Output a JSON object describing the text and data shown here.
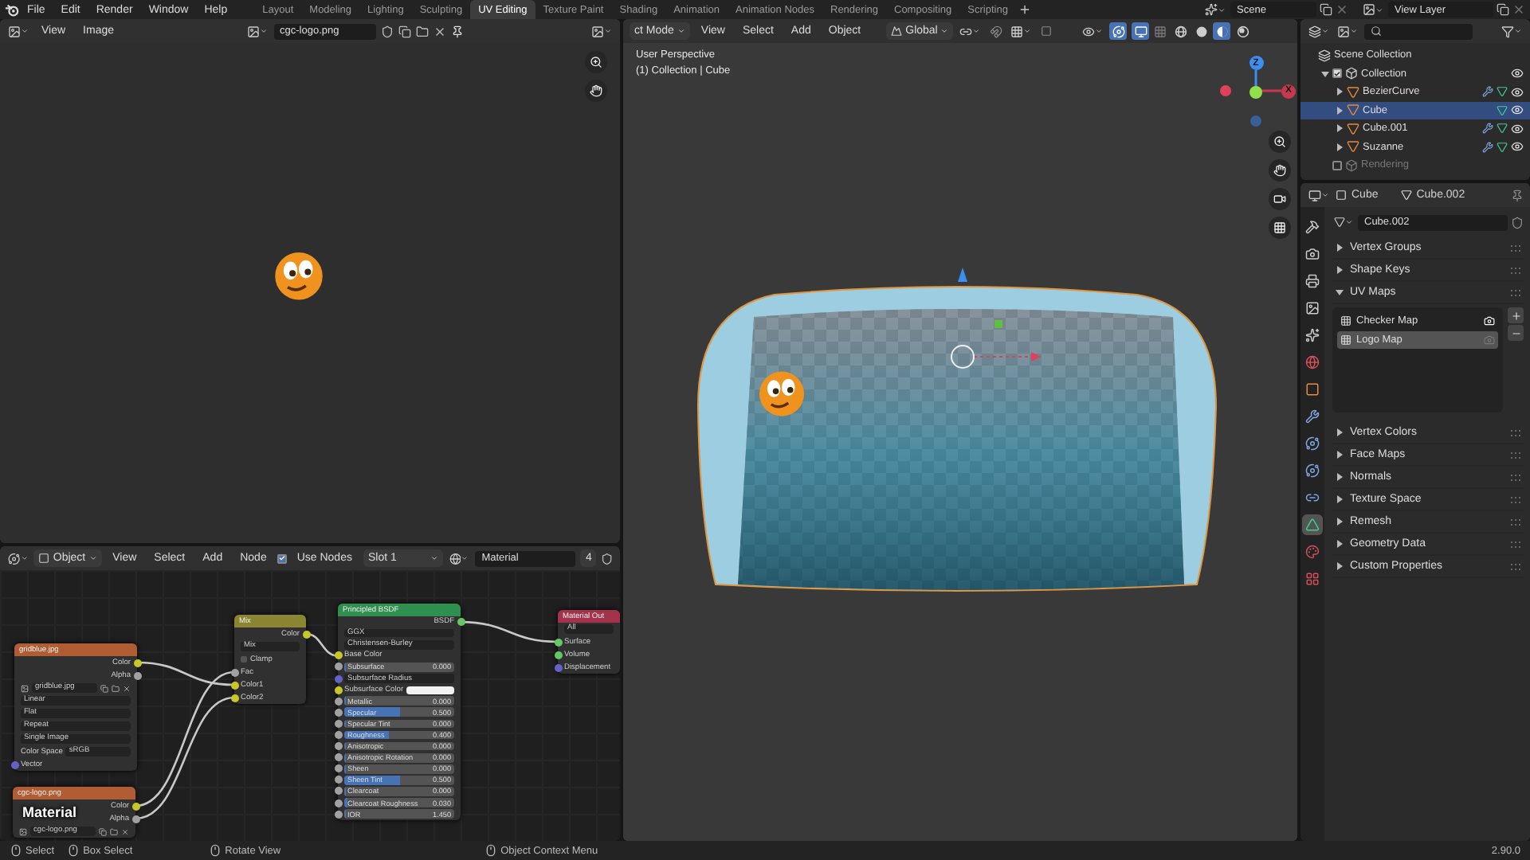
{
  "top_bar": {
    "menus": [
      "File",
      "Edit",
      "Render",
      "Window",
      "Help"
    ],
    "workspace_tabs": [
      {
        "label": "Layout",
        "selected": false
      },
      {
        "label": "Modeling",
        "selected": false
      },
      {
        "label": "Lighting",
        "selected": false
      },
      {
        "label": "Sculpting",
        "selected": false
      },
      {
        "label": "UV Editing",
        "selected": true
      },
      {
        "label": "Texture Paint",
        "selected": false
      },
      {
        "label": "Shading",
        "selected": false
      },
      {
        "label": "Animation",
        "selected": false
      },
      {
        "label": "Animation Nodes",
        "selected": false
      },
      {
        "label": "Rendering",
        "selected": false
      },
      {
        "label": "Compositing",
        "selected": false
      },
      {
        "label": "Scripting",
        "selected": false
      }
    ],
    "scene": "Scene",
    "view_layer": "View Layer"
  },
  "image_editor": {
    "menus": [
      "View",
      "Image"
    ],
    "image_name": "cgc-logo.png"
  },
  "node_editor": {
    "header": {
      "mode": "Object",
      "menus": [
        "View",
        "Select",
        "Add",
        "Node"
      ],
      "use_nodes": {
        "label": "Use Nodes",
        "checked": true
      },
      "slot": "Slot 1",
      "material": "Material",
      "users": "4"
    },
    "drag_label": "Material",
    "nodes": [
      {
        "title": "gridblue.jpg",
        "color": "#b05d33",
        "rows": [
          {
            "kind": "output",
            "label": "Color",
            "color": "#c7c729"
          },
          {
            "kind": "output",
            "label": "Alpha",
            "color": "#a1a1a1"
          },
          {
            "kind": "file",
            "value": "gridblue.jpg"
          },
          {
            "kind": "dropdown",
            "value": "Linear"
          },
          {
            "kind": "dropdown",
            "value": "Flat"
          },
          {
            "kind": "dropdown",
            "value": "Repeat"
          },
          {
            "kind": "dropdown",
            "value": "Single Image"
          },
          {
            "kind": "prop",
            "label": "Color Space",
            "value": "sRGB"
          },
          {
            "kind": "input",
            "label": "Vector",
            "color": "#6363c7"
          }
        ]
      },
      {
        "title": "cgc-logo.png",
        "color": "#b05d33",
        "rows": [
          {
            "kind": "output",
            "label": "Color",
            "color": "#c7c729"
          },
          {
            "kind": "output",
            "label": "Alpha",
            "color": "#a1a1a1"
          },
          {
            "kind": "file",
            "value": "cgc-logo.png"
          }
        ]
      },
      {
        "title": "Mix",
        "color": "#8a8532",
        "rows": [
          {
            "kind": "output",
            "label": "Color",
            "color": "#c7c729"
          },
          {
            "kind": "dropdown",
            "value": "Mix"
          },
          {
            "kind": "checkbox",
            "label": "Clamp",
            "checked": false
          },
          {
            "kind": "input",
            "label": "Fac",
            "color": "#a1a1a1"
          },
          {
            "kind": "input",
            "label": "Color1",
            "color": "#c7c729"
          },
          {
            "kind": "input",
            "label": "Color2",
            "color": "#c7c729"
          }
        ]
      },
      {
        "title": "Principled BSDF",
        "color": "#2e8f4f",
        "rows": [
          {
            "kind": "output",
            "label": "BSDF",
            "color": "#63c763"
          },
          {
            "kind": "dropdown",
            "value": "GGX"
          },
          {
            "kind": "dropdown",
            "value": "Christensen-Burley"
          },
          {
            "kind": "input",
            "label": "Base Color",
            "color": "#c7c729"
          },
          {
            "kind": "value",
            "label": "Subsurface",
            "value": "0.000",
            "level": 0,
            "color": "#a1a1a1"
          },
          {
            "kind": "dropdown",
            "value": "Subsurface Radius",
            "color": "#6363c7"
          },
          {
            "kind": "color",
            "label": "Subsurface Color",
            "color": "#c7c729"
          },
          {
            "kind": "value",
            "label": "Metallic",
            "value": "0.000",
            "level": 0,
            "color": "#a1a1a1"
          },
          {
            "kind": "value",
            "label": "Specular",
            "value": "0.500",
            "level": 0.5,
            "color": "#a1a1a1"
          },
          {
            "kind": "value",
            "label": "Specular Tint",
            "value": "0.000",
            "level": 0,
            "color": "#a1a1a1"
          },
          {
            "kind": "value",
            "label": "Roughness",
            "value": "0.400",
            "level": 0.4,
            "color": "#a1a1a1"
          },
          {
            "kind": "value",
            "label": "Anisotropic",
            "value": "0.000",
            "level": 0,
            "color": "#a1a1a1"
          },
          {
            "kind": "value",
            "label": "Anisotropic Rotation",
            "value": "0.000",
            "level": 0,
            "color": "#a1a1a1"
          },
          {
            "kind": "value",
            "label": "Sheen",
            "value": "0.000",
            "level": 0,
            "color": "#a1a1a1"
          },
          {
            "kind": "value",
            "label": "Sheen Tint",
            "value": "0.500",
            "level": 0.5,
            "color": "#a1a1a1"
          },
          {
            "kind": "value",
            "label": "Clearcoat",
            "value": "0.000",
            "level": 0,
            "color": "#a1a1a1"
          },
          {
            "kind": "value",
            "label": "Clearcoat Roughness",
            "value": "0.030",
            "level": 0.03,
            "color": "#a1a1a1"
          },
          {
            "kind": "value",
            "label": "IOR",
            "value": "1.450",
            "level": 0,
            "color": "#a1a1a1"
          }
        ]
      },
      {
        "title": "Material Out",
        "color": "#a3334a",
        "rows": [
          {
            "kind": "dropdown",
            "value": "All"
          },
          {
            "kind": "input",
            "label": "Surface",
            "color": "#63c763"
          },
          {
            "kind": "input",
            "label": "Volume",
            "color": "#63c763"
          },
          {
            "kind": "input",
            "label": "Displacement",
            "color": "#6363c7"
          }
        ]
      }
    ]
  },
  "viewport": {
    "header": {
      "mode": "ct Mode",
      "menus": [
        "View",
        "Select",
        "Add",
        "Object"
      ],
      "orientation": "Global",
      "shading_modes": [
        {
          "kind": "wireframe",
          "selected": false
        },
        {
          "kind": "solid",
          "selected": false
        },
        {
          "kind": "material",
          "selected": true
        },
        {
          "kind": "rendered",
          "selected": false
        }
      ]
    },
    "info": [
      "User Perspective",
      "(1) Collection | Cube"
    ],
    "gizmo": {
      "z": "Z",
      "x": "X"
    }
  },
  "outliner": {
    "tree": [
      {
        "name": "Scene Collection",
        "kind": "scene",
        "selected": false,
        "children": [
          {
            "name": "Collection",
            "kind": "collection",
            "checked": true,
            "expanded": true,
            "selected": false,
            "children": [
              {
                "name": "BezierCurve",
                "kind": "object",
                "expanded": false,
                "selected": false,
                "modifiers": true
              },
              {
                "name": "Cube",
                "kind": "object",
                "expanded": false,
                "selected": true,
                "modifiers": false
              },
              {
                "name": "Cube.001",
                "kind": "object",
                "expanded": false,
                "selected": false,
                "modifiers": true
              },
              {
                "name": "Suzanne",
                "kind": "object",
                "expanded": false,
                "selected": false,
                "modifiers": true
              }
            ]
          },
          {
            "name": "Rendering",
            "kind": "collection",
            "checked": false,
            "selected": false
          }
        ]
      }
    ]
  },
  "properties": {
    "object": "Cube",
    "mesh": "Cube.002",
    "mesh_field": "Cube.002",
    "tabs": [
      {
        "kind": "tool",
        "selected": false
      },
      {
        "kind": "render",
        "selected": false
      },
      {
        "kind": "output",
        "selected": false
      },
      {
        "kind": "view_layer",
        "selected": false
      },
      {
        "kind": "scene",
        "selected": false
      },
      {
        "kind": "world",
        "selected": false
      },
      {
        "kind": "object",
        "selected": false
      },
      {
        "kind": "modifiers",
        "selected": false
      },
      {
        "kind": "particles",
        "selected": false
      },
      {
        "kind": "physics",
        "selected": false
      },
      {
        "kind": "constraints",
        "selected": false
      },
      {
        "kind": "data",
        "selected": true
      },
      {
        "kind": "material",
        "selected": false
      },
      {
        "kind": "texture",
        "selected": false
      }
    ],
    "panels": [
      {
        "label": "Vertex Groups",
        "expanded": false
      },
      {
        "label": "Shape Keys",
        "expanded": false
      },
      {
        "label": "UV Maps",
        "expanded": true,
        "uv_maps": [
          {
            "name": "Checker Map",
            "selected": false,
            "active_render": true
          },
          {
            "name": "Logo Map",
            "selected": true,
            "active_render": false
          }
        ]
      },
      {
        "label": "Vertex Colors",
        "expanded": false
      },
      {
        "label": "Face Maps",
        "expanded": false
      },
      {
        "label": "Normals",
        "expanded": false
      },
      {
        "label": "Texture Space",
        "expanded": false
      },
      {
        "label": "Remesh",
        "expanded": false
      },
      {
        "label": "Geometry Data",
        "expanded": false
      },
      {
        "label": "Custom Properties",
        "expanded": false
      }
    ]
  },
  "status_bar": {
    "hints": [
      "Select",
      "Box Select",
      "Rotate View",
      "Object Context Menu"
    ],
    "version": "2.90.0"
  }
}
